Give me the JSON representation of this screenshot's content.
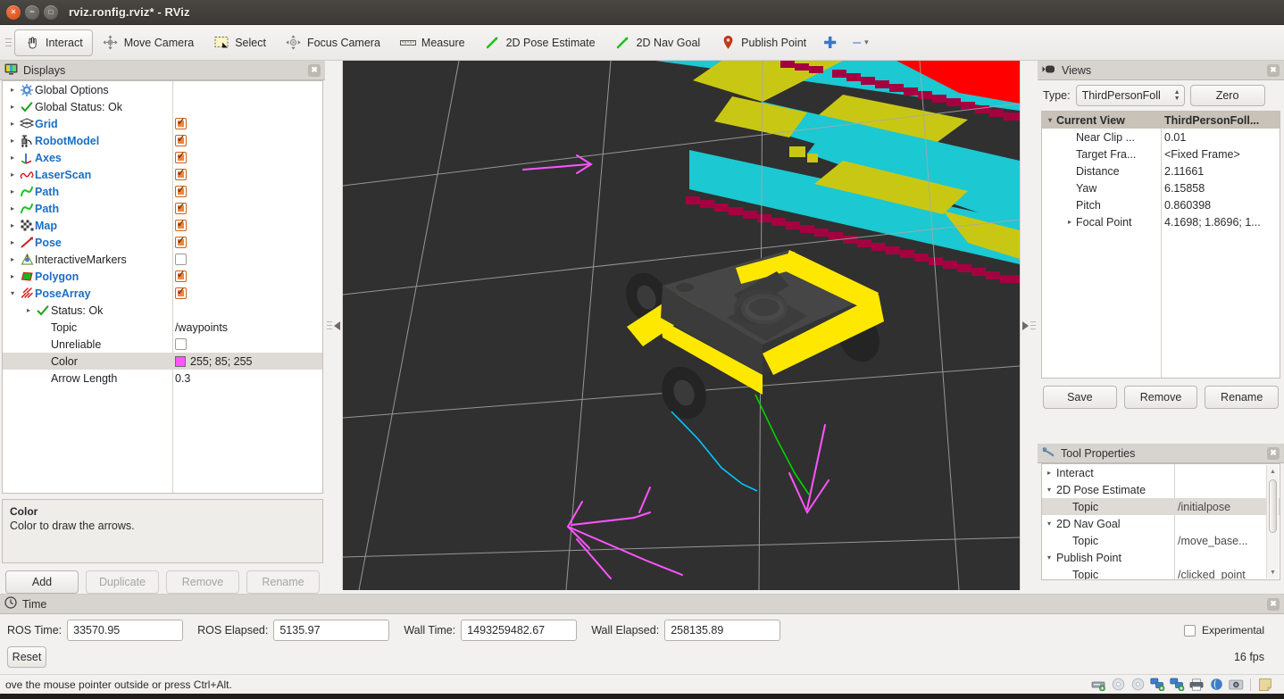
{
  "window": {
    "title": "rviz.ronfig.rviz* - RViz",
    "close_label": "×",
    "min_label": "−",
    "max_label": "□"
  },
  "toolbar": {
    "items": [
      {
        "label": "Interact",
        "icon": "hand-cursor-icon",
        "active": true
      },
      {
        "label": "Move Camera",
        "icon": "move-camera-icon",
        "active": false
      },
      {
        "label": "Select",
        "icon": "select-box-icon",
        "active": false
      },
      {
        "label": "Focus Camera",
        "icon": "focus-camera-icon",
        "active": false
      },
      {
        "label": "Measure",
        "icon": "ruler-icon",
        "active": false
      },
      {
        "label": "2D Pose Estimate",
        "icon": "green-arrow-icon",
        "active": false
      },
      {
        "label": "2D Nav Goal",
        "icon": "green-arrow-icon",
        "active": false
      },
      {
        "label": "Publish Point",
        "icon": "map-pin-icon",
        "active": false
      }
    ],
    "plus_label": "✚",
    "minus_label": "–",
    "caret_label": "▾"
  },
  "displays": {
    "header": {
      "title": "Displays",
      "icon": "monitor-icon",
      "close": "✖"
    },
    "tree": [
      {
        "indent": 0,
        "arrow": "▸",
        "icon": "gear-icon",
        "label": "Global Options",
        "style": "plain",
        "value_type": "none"
      },
      {
        "indent": 0,
        "arrow": "▸",
        "icon": "check-icon",
        "label": "Global Status: Ok",
        "style": "plain",
        "value_type": "none"
      },
      {
        "indent": 0,
        "arrow": "▸",
        "icon": "grid-icon",
        "label": "Grid",
        "style": "blue",
        "value_type": "checkbox",
        "checked": true
      },
      {
        "indent": 0,
        "arrow": "▸",
        "icon": "robot-icon",
        "label": "RobotModel",
        "style": "blue",
        "value_type": "checkbox",
        "checked": true
      },
      {
        "indent": 0,
        "arrow": "▸",
        "icon": "axes-icon",
        "label": "Axes",
        "style": "blue",
        "value_type": "checkbox",
        "checked": true
      },
      {
        "indent": 0,
        "arrow": "▸",
        "icon": "laserscan-icon",
        "label": "LaserScan",
        "style": "blue",
        "value_type": "checkbox",
        "checked": true
      },
      {
        "indent": 0,
        "arrow": "▸",
        "icon": "path-icon",
        "label": "Path",
        "style": "blue",
        "value_type": "checkbox",
        "checked": true
      },
      {
        "indent": 0,
        "arrow": "▸",
        "icon": "path-icon",
        "label": "Path",
        "style": "blue",
        "value_type": "checkbox",
        "checked": true
      },
      {
        "indent": 0,
        "arrow": "▸",
        "icon": "map-icon",
        "label": "Map",
        "style": "blue",
        "value_type": "checkbox",
        "checked": true
      },
      {
        "indent": 0,
        "arrow": "▸",
        "icon": "pose-icon",
        "label": "Pose",
        "style": "blue",
        "value_type": "checkbox",
        "checked": true
      },
      {
        "indent": 0,
        "arrow": "▸",
        "icon": "interactive-markers-icon",
        "label": "InteractiveMarkers",
        "style": "plain",
        "value_type": "checkbox",
        "checked": false
      },
      {
        "indent": 0,
        "arrow": "▸",
        "icon": "polygon-icon",
        "label": "Polygon",
        "style": "blue",
        "value_type": "checkbox",
        "checked": true
      },
      {
        "indent": 0,
        "arrow": "▾",
        "icon": "posearray-icon",
        "label": "PoseArray",
        "style": "blue",
        "value_type": "checkbox",
        "checked": true
      },
      {
        "indent": 1,
        "arrow": "▸",
        "icon": "check-icon",
        "label": "Status: Ok",
        "style": "plain",
        "value_type": "none"
      },
      {
        "indent": 1,
        "arrow": "",
        "icon": "",
        "label": "Topic",
        "style": "plain",
        "value_type": "text",
        "value": "/waypoints"
      },
      {
        "indent": 1,
        "arrow": "",
        "icon": "",
        "label": "Unreliable",
        "style": "plain",
        "value_type": "checkbox",
        "checked": false
      },
      {
        "indent": 1,
        "arrow": "",
        "icon": "",
        "label": "Color",
        "style": "plain",
        "value_type": "color",
        "value": "255; 85; 255",
        "color": "#ff55ff",
        "selected": true
      },
      {
        "indent": 1,
        "arrow": "",
        "icon": "",
        "label": "Arrow Length",
        "style": "plain",
        "value_type": "text",
        "value": "0.3"
      }
    ],
    "description": {
      "title": "Color",
      "text": "Color to draw the arrows."
    },
    "buttons": [
      {
        "label": "Add",
        "enabled": true
      },
      {
        "label": "Duplicate",
        "enabled": false
      },
      {
        "label": "Remove",
        "enabled": false
      },
      {
        "label": "Rename",
        "enabled": false
      }
    ]
  },
  "views": {
    "header": {
      "title": "Views",
      "icon": "camera-icon",
      "close": "✖"
    },
    "type_label": "Type:",
    "type_value": "ThirdPersonFoll",
    "zero_label": "Zero",
    "rows": [
      {
        "arrow": "▾",
        "name": "Current View",
        "value": "ThirdPersonFoll...",
        "header": true
      },
      {
        "arrow": "",
        "name": "Near Clip ...",
        "value": "0.01",
        "header": false
      },
      {
        "arrow": "",
        "name": "Target Fra...",
        "value": "<Fixed Frame>",
        "header": false
      },
      {
        "arrow": "",
        "name": "Distance",
        "value": "2.11661",
        "header": false
      },
      {
        "arrow": "",
        "name": "Yaw",
        "value": "6.15858",
        "header": false
      },
      {
        "arrow": "",
        "name": "Pitch",
        "value": "0.860398",
        "header": false
      },
      {
        "arrow": "▸",
        "name": "Focal Point",
        "value": "4.1698; 1.8696; 1...",
        "header": false
      }
    ],
    "buttons": [
      {
        "label": "Save"
      },
      {
        "label": "Remove"
      },
      {
        "label": "Rename"
      }
    ]
  },
  "tool_properties": {
    "header": {
      "title": "Tool Properties",
      "icon": "wrench-icon",
      "close": "✖"
    },
    "rows": [
      {
        "arrow": "▸",
        "indent": 0,
        "name": "Interact",
        "value": "",
        "selected": false
      },
      {
        "arrow": "▾",
        "indent": 0,
        "name": "2D Pose Estimate",
        "value": "",
        "selected": false
      },
      {
        "arrow": "",
        "indent": 1,
        "name": "Topic",
        "value": "/initialpose",
        "selected": true
      },
      {
        "arrow": "▾",
        "indent": 0,
        "name": "2D Nav Goal",
        "value": "",
        "selected": false
      },
      {
        "arrow": "",
        "indent": 1,
        "name": "Topic",
        "value": "/move_base...",
        "selected": false
      },
      {
        "arrow": "▾",
        "indent": 0,
        "name": "Publish Point",
        "value": "",
        "selected": false
      },
      {
        "arrow": "",
        "indent": 1,
        "name": "Topic",
        "value": "/clicked_point",
        "selected": false
      }
    ]
  },
  "time": {
    "header": {
      "title": "Time",
      "icon": "clock-icon",
      "close": "✖"
    },
    "fields": [
      {
        "label": "ROS Time:",
        "value": "33570.95"
      },
      {
        "label": "ROS Elapsed:",
        "value": "5135.97"
      },
      {
        "label": "Wall Time:",
        "value": "1493259482.67"
      },
      {
        "label": "Wall Elapsed:",
        "value": "258135.89"
      }
    ],
    "experimental_label": "Experimental",
    "experimental_checked": false,
    "reset_label": "Reset",
    "fps": "16 fps"
  },
  "statusbar": {
    "message": "ove the mouse pointer outside or press Ctrl+Alt.",
    "tray": [
      "drive-icon",
      "disc-icon",
      "disc-icon",
      "network-icon",
      "network-icon",
      "printer-icon",
      "ubuntu-icon",
      "camera-icon"
    ],
    "tray_extra": "note-icon"
  },
  "viewport": {
    "background": "#303030",
    "grid_color": "#a8a8a8",
    "map_colors": {
      "free": "#2f2f2f",
      "inflation_cyan": "#1cc8d2",
      "inflation_olive": "#c8c814",
      "lethal_red": "#ff0000",
      "obstacle_maroon": "#a50040"
    },
    "robot": {
      "body_color": "#3c3c3c",
      "bumper_color": "#ffe800",
      "wheel_color": "#262626"
    },
    "paths": {
      "global_plan": "#00d400",
      "local_plan": "#00c8ff"
    },
    "pose_array_color": "#ff55ff"
  }
}
